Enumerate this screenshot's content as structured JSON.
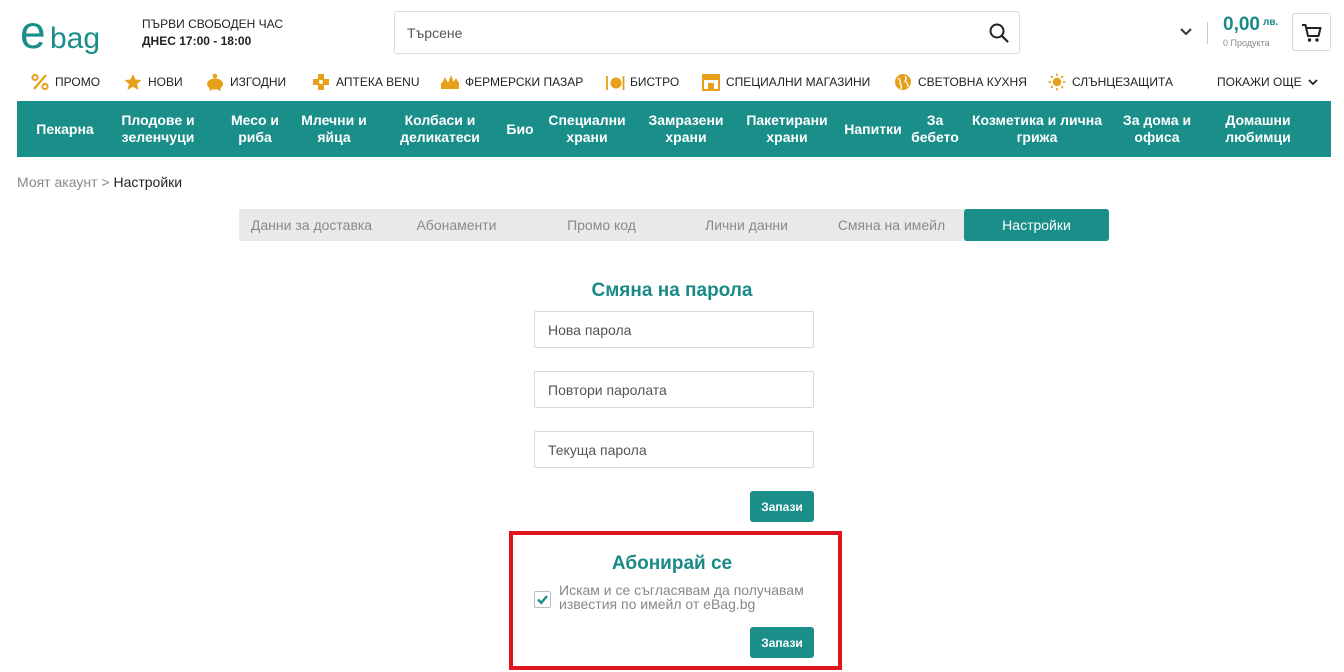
{
  "colors": {
    "accent": "#1a8e89",
    "highlight_border": "#e0141c"
  },
  "header": {
    "logo_text": "ebag",
    "delivery_line1": "ПЪРВИ СВОБОДЕН ЧАС",
    "delivery_line2": "ДНЕС 17:00 - 18:00",
    "search_placeholder": "Търсене",
    "cart_total": "0,00",
    "currency": "лв.",
    "cart_count": "0 Продукта"
  },
  "subnav": [
    {
      "icon": "percent-icon",
      "label": "ПРОМО"
    },
    {
      "icon": "star-icon",
      "label": "НОВИ"
    },
    {
      "icon": "piggy-bank-icon",
      "label": "ИЗГОДНИ"
    },
    {
      "icon": "pharmacy-cross-icon",
      "label": "АПТЕКА BENU"
    },
    {
      "icon": "farmers-market-icon",
      "label": "ФЕРМЕРСКИ ПАЗАР"
    },
    {
      "icon": "bistro-icon",
      "label": "БИСТРО"
    },
    {
      "icon": "store-icon",
      "label": "СПЕЦИАЛНИ МАГАЗИНИ"
    },
    {
      "icon": "globe-icon",
      "label": "СВЕТОВНА КУХНЯ"
    },
    {
      "icon": "sun-icon",
      "label": "СЛЪНЦЕЗАЩИТА"
    }
  ],
  "show_more": "ПОКАЖИ ОЩЕ",
  "categories": [
    {
      "l1": "Пекарна",
      "l2": ""
    },
    {
      "l1": "Плодове и",
      "l2": "зеленчуци"
    },
    {
      "l1": "Месо и",
      "l2": "риба"
    },
    {
      "l1": "Млечни и",
      "l2": "яйца"
    },
    {
      "l1": "Колбаси и",
      "l2": "деликатеси"
    },
    {
      "l1": "Био",
      "l2": ""
    },
    {
      "l1": "Специални",
      "l2": "храни"
    },
    {
      "l1": "Замразени",
      "l2": "храни"
    },
    {
      "l1": "Пакетирани",
      "l2": "храни"
    },
    {
      "l1": "Напитки",
      "l2": ""
    },
    {
      "l1": "За",
      "l2": "бебето"
    },
    {
      "l1": "Козметика и лична",
      "l2": "грижа"
    },
    {
      "l1": "За дома и",
      "l2": "офиса"
    },
    {
      "l1": "Домашни",
      "l2": "любимци"
    }
  ],
  "breadcrumb": {
    "parent": "Моят акаунт",
    "separator": ">",
    "current": "Настройки"
  },
  "tabs": [
    "Данни за доставка",
    "Абонаменти",
    "Промо код",
    "Лични данни",
    "Смяна на имейл",
    "Настройки"
  ],
  "password_form": {
    "title": "Смяна на парола",
    "new_password_placeholder": "Нова парола",
    "repeat_password_placeholder": "Повтори паролата",
    "current_password_placeholder": "Текуща парола",
    "save_label": "Запази"
  },
  "subscribe": {
    "title": "Абонирай се",
    "consent_text": "Искам и се съгласявам да получавам известия по имейл от eBag.bg",
    "checked": true,
    "save_label": "Запази"
  }
}
